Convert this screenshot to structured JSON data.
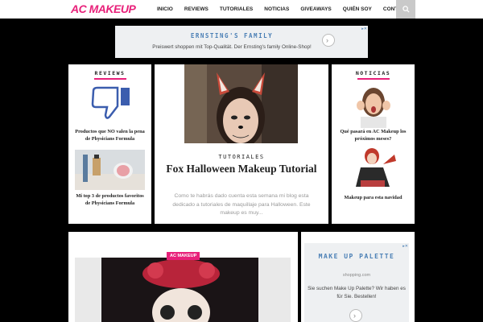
{
  "header": {
    "logo": "AC MAKEUP",
    "nav": [
      "INICIO",
      "REVIEWS",
      "TUTORIALES",
      "NOTICIAS",
      "GIVEAWAYS",
      "QUIÉN SOY",
      "CONTACTO"
    ],
    "search_icon": "search-icon"
  },
  "ad_top": {
    "title": "ERNSTING'S FAMILY",
    "subtitle": "Preiswert shoppen mit Top-Qualität. Der Ernsting's family Online-Shop!"
  },
  "reviews": {
    "heading": "REVIEWS",
    "items": [
      {
        "title": "Productos que NO valen la pena de Physicians Formula"
      },
      {
        "title": "Mi top 3 de productos favoritos de Physicians Formula"
      }
    ]
  },
  "featured": {
    "category": "TUTORIALES",
    "title": "Fox Halloween Makeup Tutorial",
    "excerpt": "Como te habrás dado cuenta esta semana mi blog esta dedicado a tutoriales de maquillaje para Halloween. Este makeup es muy..."
  },
  "noticias": {
    "heading": "NOTICIAS",
    "items": [
      {
        "title": "Qué pasará en AC Makeup los próximos meses?"
      },
      {
        "title": "Makeup para esta navidad"
      }
    ]
  },
  "second_post": {
    "badge": "AC MAKEUP"
  },
  "ad_side": {
    "title": "MAKE UP PALETTE",
    "domain": "shopping.com",
    "text": "Sie suchen Make Up Palette? Wir haben es für Sie. Bestellen!"
  },
  "colors": {
    "accent": "#e8217a",
    "ad_blue": "#4a7fb5",
    "background": "#000000"
  }
}
